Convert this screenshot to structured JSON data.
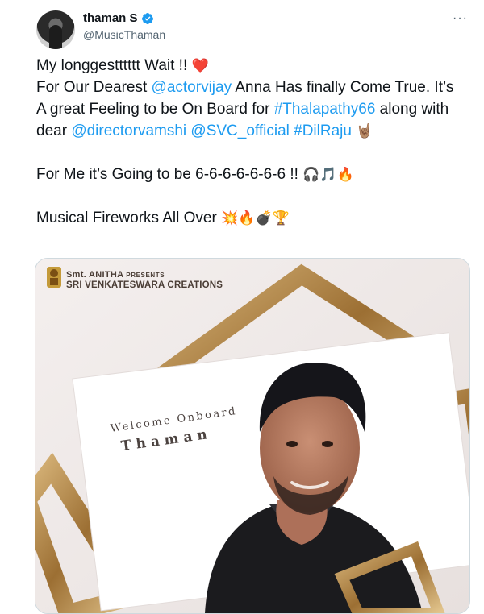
{
  "author": {
    "display_name": "thaman S",
    "handle": "@MusicThaman",
    "verified_icon": "verified-badge-icon",
    "avatar_icon": "avatar-photo"
  },
  "more_label": "···",
  "tweet": {
    "line1_text": "My longgestttttt Wait !! ",
    "line1_emoji": "❤️",
    "line2_pre": "For Our Dearest ",
    "mention_vijay": "@actorvijay",
    "line2_post": " Anna Has finally Come True. It’s A great Feeling to be On Board for ",
    "hashtag_thalapathy": "#Thalapathy66",
    "line3_mid": " along with dear ",
    "mention_vamshi": "@directorvamshi",
    "mention_svc": "@SVC_official",
    "hashtag_dilraju": "#DilRaju",
    "line4_emoji": "🤘🏽",
    "line5_text": "For Me it’s Going to be 6-6-6-6-6-6-6 !! ",
    "line5_emoji": "🎧🎵🔥",
    "line6_text": "Musical Fireworks All Over ",
    "line6_emoji": "💥🔥💣🏆"
  },
  "media": {
    "presenter": "Smt. ANITHA",
    "presents": "PRESENTS",
    "production": "SRI VENKATESWARA CREATIONS",
    "welcome": "Welcome Onboard",
    "name": "Thaman"
  },
  "colors": {
    "link": "#1d9bf0",
    "text": "#0f1419",
    "muted": "#536471",
    "frame_gold": "#b58a4c"
  }
}
